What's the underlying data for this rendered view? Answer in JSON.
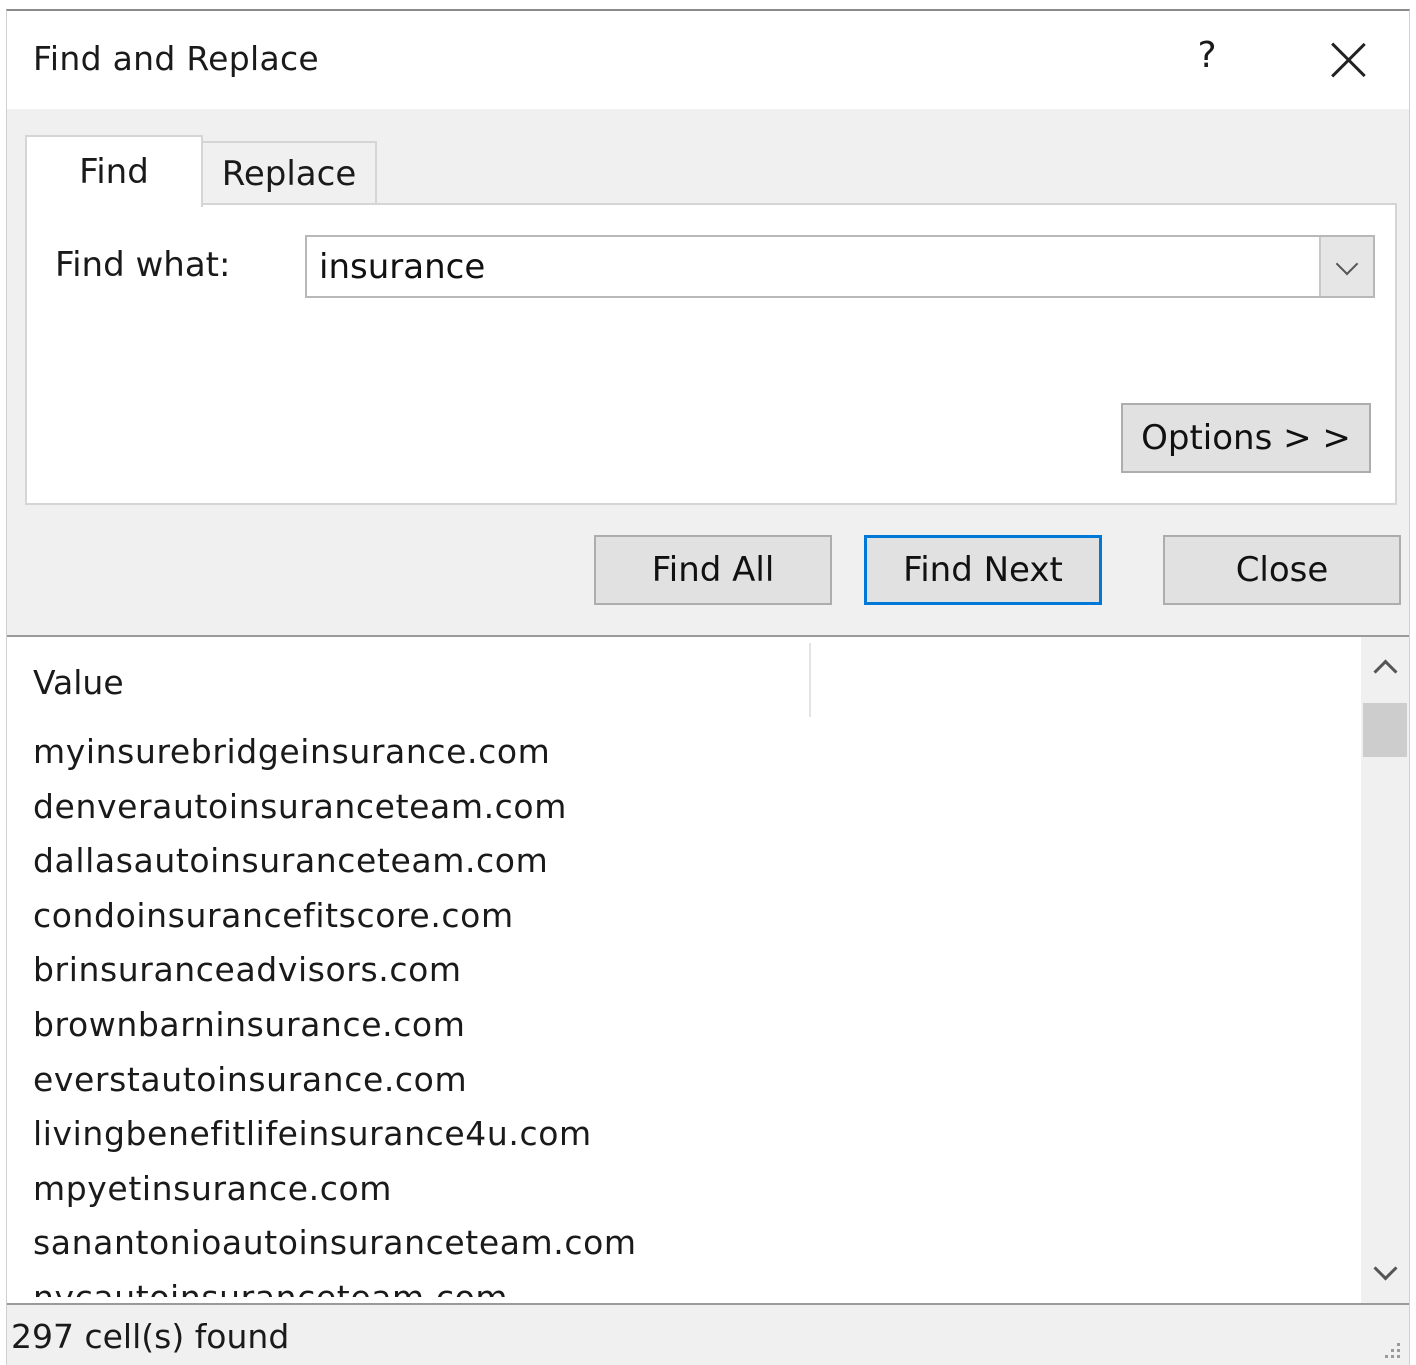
{
  "dialog": {
    "title": "Find and Replace",
    "help_label": "?"
  },
  "tabs": [
    {
      "label": "Find",
      "active": true
    },
    {
      "label": "Replace",
      "active": false
    }
  ],
  "find": {
    "label": "Find what:",
    "value": "insurance"
  },
  "buttons": {
    "options": "Options > >",
    "find_all": "Find All",
    "find_next": "Find Next",
    "close": "Close"
  },
  "results": {
    "column_header": "Value",
    "rows": [
      "myinsurebridgeinsurance.com",
      "denverautoinsuranceteam.com",
      "dallasautoinsuranceteam.com",
      "condoinsurancefitscore.com",
      "brinsuranceadvisors.com",
      "brownbarninsurance.com",
      "everstautoinsurance.com",
      "livingbenefitlifeinsurance4u.com",
      "mpyetinsurance.com",
      "sanantonioautoinsuranceteam.com",
      "nycautoinsuranceteam.com"
    ]
  },
  "status": "297 cell(s) found",
  "colors": {
    "focus_border": "#0078d7",
    "dialog_bg": "#f0f0f0"
  }
}
